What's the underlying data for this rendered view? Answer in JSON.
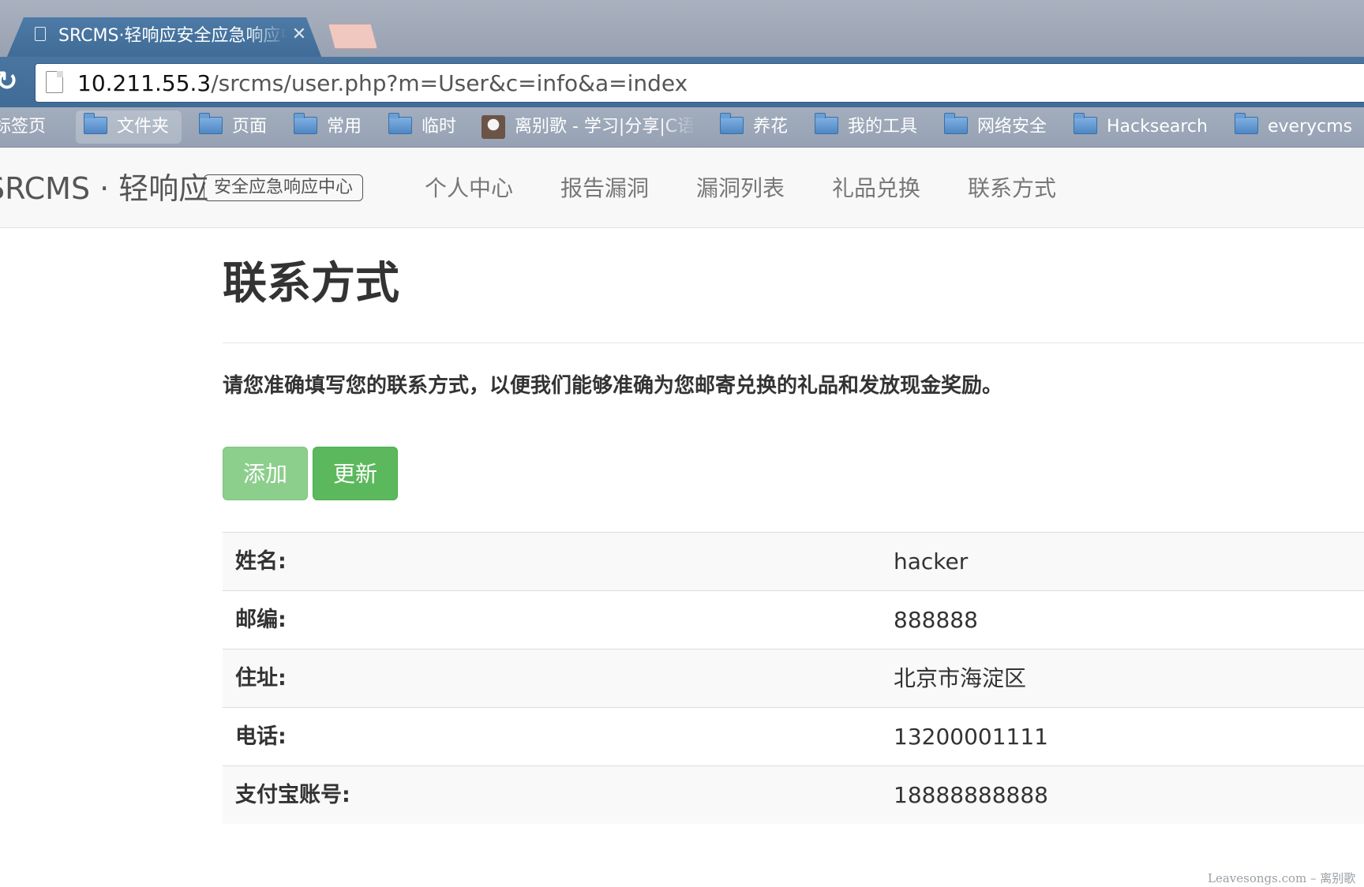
{
  "browser": {
    "tab_title": "SRCMS·轻响应安全应急响应中心",
    "close_glyph": "✕",
    "url_host": "10.211.55.3",
    "url_path": "/srcms/user.php?m=User&c=info&a=index",
    "reload_glyph": "↻"
  },
  "bookmarks": [
    {
      "label": "动标签页",
      "icon": "none"
    },
    {
      "label": "文件夹",
      "icon": "folder-icon"
    },
    {
      "label": "页面",
      "icon": "folder-icon"
    },
    {
      "label": "常用",
      "icon": "folder-icon"
    },
    {
      "label": "临时",
      "icon": "folder-icon"
    },
    {
      "label": "离别歌 - 学习|分享|C语言",
      "icon": "site-thumbnail-icon"
    },
    {
      "label": "养花",
      "icon": "folder-icon"
    },
    {
      "label": "我的工具",
      "icon": "folder-icon"
    },
    {
      "label": "网络安全",
      "icon": "folder-icon"
    },
    {
      "label": "Hacksearch",
      "icon": "folder-icon"
    },
    {
      "label": "everycms",
      "icon": "folder-icon"
    }
  ],
  "navbar": {
    "brand": "SRCMS · 轻响应",
    "badge": "安全应急响应中心",
    "links": [
      "个人中心",
      "报告漏洞",
      "漏洞列表",
      "礼品兑换",
      "联系方式"
    ]
  },
  "main": {
    "title": "联系方式",
    "intro": "请您准确填写您的联系方式，以便我们能够准确为您邮寄兑换的礼品和发放现金奖励。",
    "add_button": "添加",
    "update_button": "更新",
    "rows": [
      {
        "label": "姓名:",
        "value": "hacker"
      },
      {
        "label": "邮编:",
        "value": "888888"
      },
      {
        "label": "住址:",
        "value": "北京市海淀区"
      },
      {
        "label": "电话:",
        "value": "13200001111"
      },
      {
        "label": "支付宝账号:",
        "value": "18888888888"
      }
    ]
  },
  "watermark": "Leavesongs.com – 离别歌",
  "colors": {
    "chrome_blue": "#3f6b96",
    "btn_success": "#5cb85c",
    "btn_success_disabled": "#8ccf8c",
    "text": "#333333"
  }
}
